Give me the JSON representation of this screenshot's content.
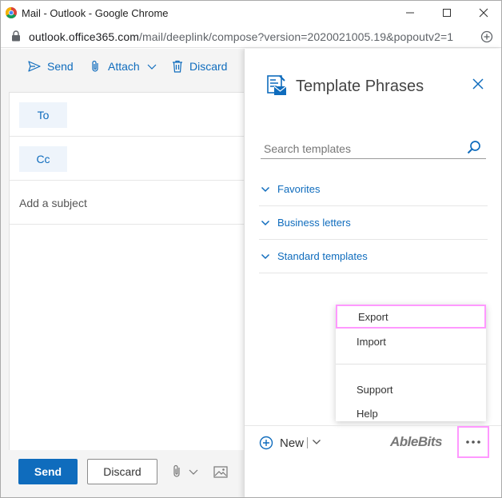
{
  "window": {
    "title": "Mail - Outlook - Google Chrome"
  },
  "address": {
    "host": "outlook.office365.com",
    "path": "/mail/deeplink/compose?version=2020021005.19&popoutv2=1"
  },
  "compose": {
    "toolbar": {
      "send": "Send",
      "attach": "Attach",
      "discard": "Discard"
    },
    "to_label": "To",
    "cc_label": "Cc",
    "subject_placeholder": "Add a subject",
    "footer": {
      "send": "Send",
      "discard": "Discard"
    }
  },
  "panel": {
    "title": "Template Phrases",
    "search_placeholder": "Search templates",
    "categories": [
      "Favorites",
      "Business letters",
      "Standard templates"
    ],
    "menu": [
      "Export",
      "Import",
      "Support",
      "Help"
    ],
    "new_label": "New",
    "brand": "AbleBits"
  },
  "colors": {
    "accent": "#0f6cbd",
    "highlight": "#ff99ff"
  }
}
